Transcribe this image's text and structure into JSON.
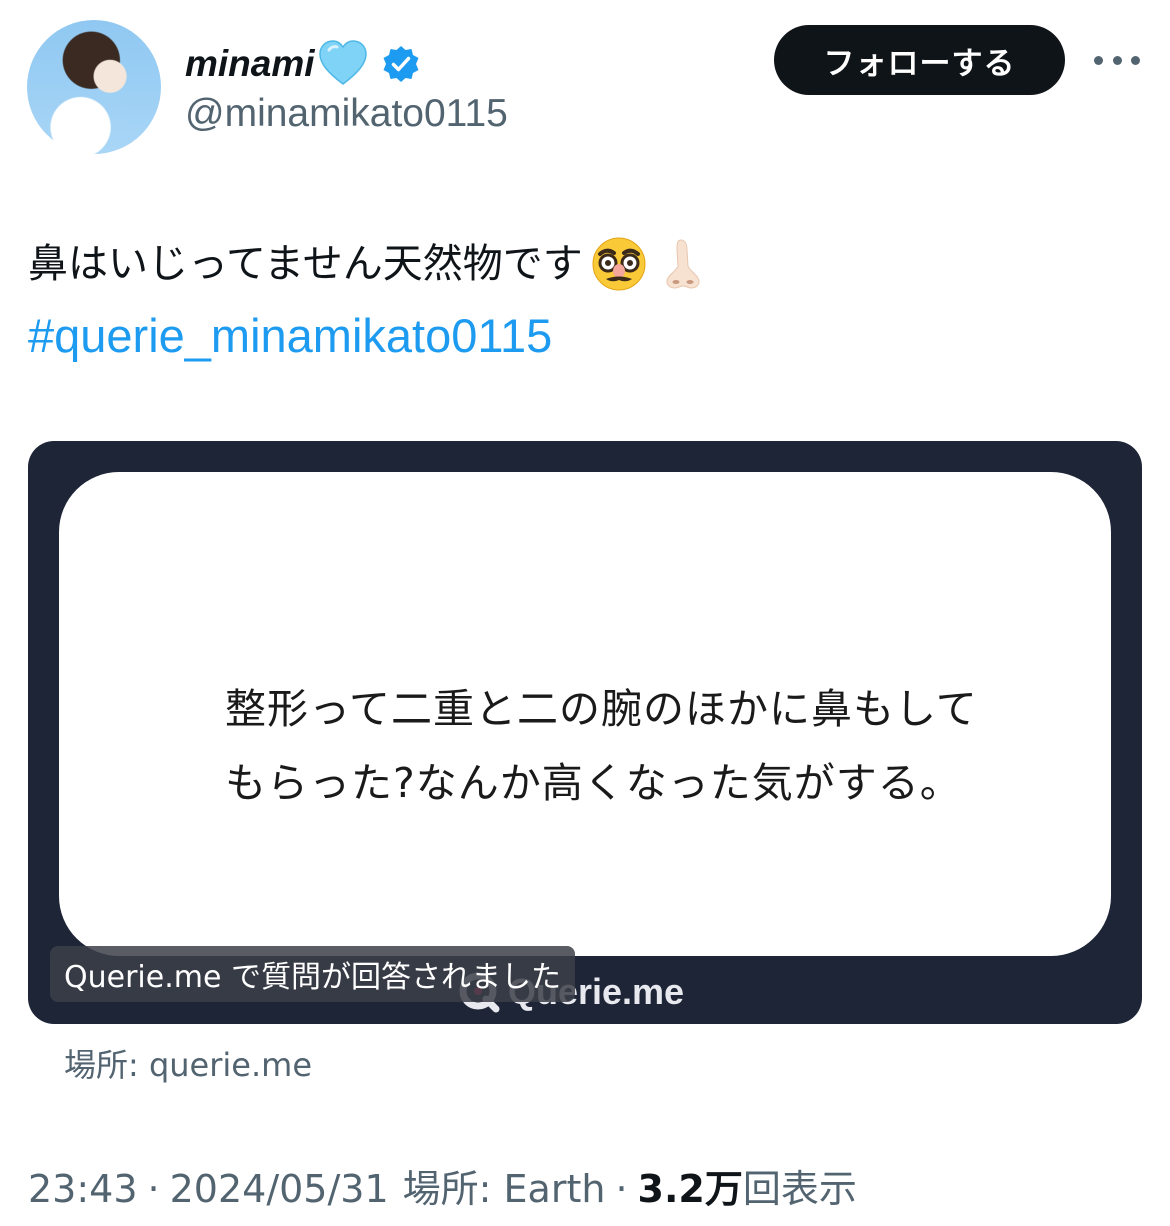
{
  "author": {
    "name": "minami",
    "handle": "@minamikato0115",
    "heart_icon": "light-blue-heart-emoji",
    "verified_icon": "verified-badge-icon"
  },
  "header": {
    "follow_label": "フォローする",
    "more_icon": "more-horizontal-icon"
  },
  "tweet": {
    "text": "鼻はいじってません天然物です",
    "emojis": [
      "disguised-face-emoji",
      "nose-emoji"
    ],
    "hashtag": "#querie_minamikato0115"
  },
  "card": {
    "question_line1": "整形って二重と二の腕のほかに鼻もして",
    "question_line2": "もらった?なんか高くなった気がする。",
    "caption": "Querie.me で質問が回答されました",
    "logo_text": "Querie.me",
    "background_color": "#1e2537"
  },
  "source": "場所: querie.me",
  "meta": {
    "time": "23:43",
    "date": "2024/05/31",
    "location": "場所: Earth",
    "views_count": "3.2万",
    "views_label": "回表示",
    "separator": "·"
  },
  "colors": {
    "link": "#1d9bf0",
    "secondary_text": "#536471",
    "primary_text": "#0f1419"
  }
}
